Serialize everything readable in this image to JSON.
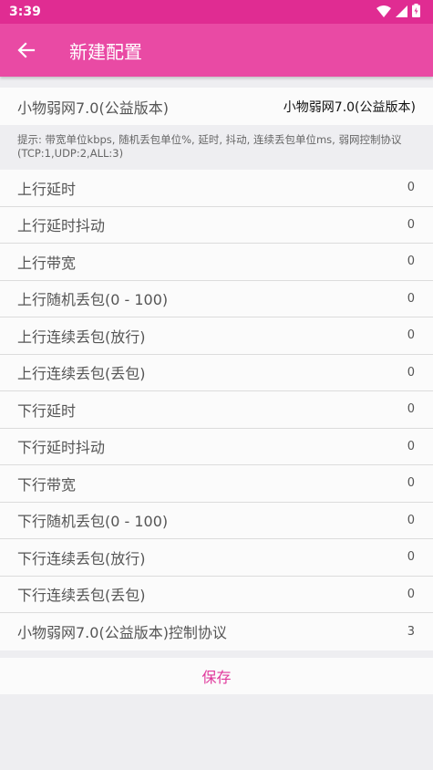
{
  "status_bar": {
    "time": "3:39",
    "icons": [
      "wifi-icon",
      "signal-icon",
      "battery-icon"
    ]
  },
  "app_bar": {
    "title": "新建配置",
    "back_icon": "arrow-left-icon"
  },
  "profile": {
    "label": "小物弱网7.0(公益版本)",
    "value": "小物弱网7.0(公益版本)"
  },
  "hint": "提示: 带宽单位kbps, 随机丢包单位%, 延时, 抖动, 连续丢包单位ms, 弱网控制协议(TCP:1,UDP:2,ALL:3)",
  "settings": [
    {
      "label": "上行延时",
      "value": "0"
    },
    {
      "label": "上行延时抖动",
      "value": "0"
    },
    {
      "label": "上行带宽",
      "value": "0"
    },
    {
      "label": "上行随机丢包(0 - 100)",
      "value": "0"
    },
    {
      "label": "上行连续丢包(放行)",
      "value": "0"
    },
    {
      "label": "上行连续丢包(丢包)",
      "value": "0"
    },
    {
      "label": "下行延时",
      "value": "0"
    },
    {
      "label": "下行延时抖动",
      "value": "0"
    },
    {
      "label": "下行带宽",
      "value": "0"
    },
    {
      "label": "下行随机丢包(0 - 100)",
      "value": "0"
    },
    {
      "label": "下行连续丢包(放行)",
      "value": "0"
    },
    {
      "label": "下行连续丢包(丢包)",
      "value": "0"
    },
    {
      "label": "小物弱网7.0(公益版本)控制协议",
      "value": "3"
    }
  ],
  "save_label": "保存",
  "colors": {
    "status_bar": "#e02c92",
    "app_bar": "#e94aa4",
    "accent": "#e0389c",
    "background": "#eeeef1"
  }
}
